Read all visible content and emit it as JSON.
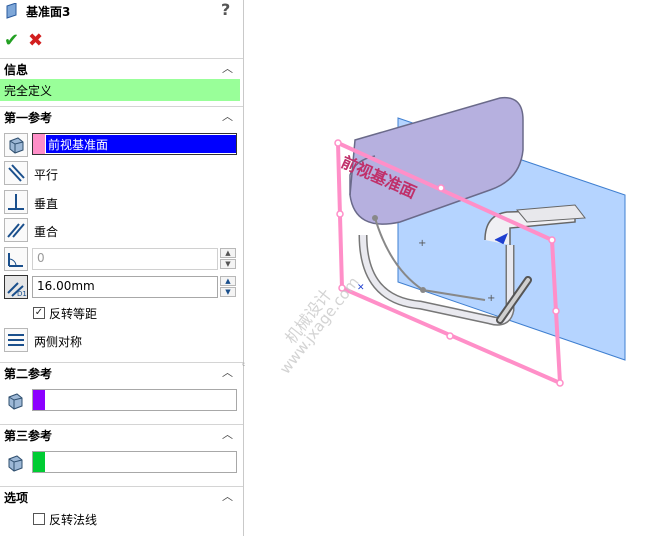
{
  "title": "基准面3",
  "help_label": "?",
  "sections": {
    "info": {
      "label": "信息",
      "status": "完全定义"
    },
    "first_ref": {
      "label": "第一参考",
      "selection": "前视基准面",
      "options": {
        "parallel": "平行",
        "perpendicular": "垂直",
        "coincident": "重合",
        "symmetric": "两侧对称"
      },
      "angle_value": "0",
      "distance_value": "16.00mm",
      "flip_offset": "反转等距"
    },
    "second_ref": {
      "label": "第二参考"
    },
    "third_ref": {
      "label": "第三参考"
    },
    "options": {
      "label": "选项",
      "flip_normal": "反转法线"
    }
  },
  "viewport": {
    "plane_label": "前视基准面",
    "watermark_cn": "机械设计",
    "watermark_en": "www.jxage.com"
  },
  "colors": {
    "status_bg": "#99ff99",
    "first_ref_swatch": "#ff8fc8",
    "selection_bg": "#0000ff",
    "second_ref_swatch": "#8c00ff",
    "third_ref_swatch": "#00cc33",
    "plane_edge": "#ff8fc8",
    "plane_fill": "#5aa0ff"
  }
}
